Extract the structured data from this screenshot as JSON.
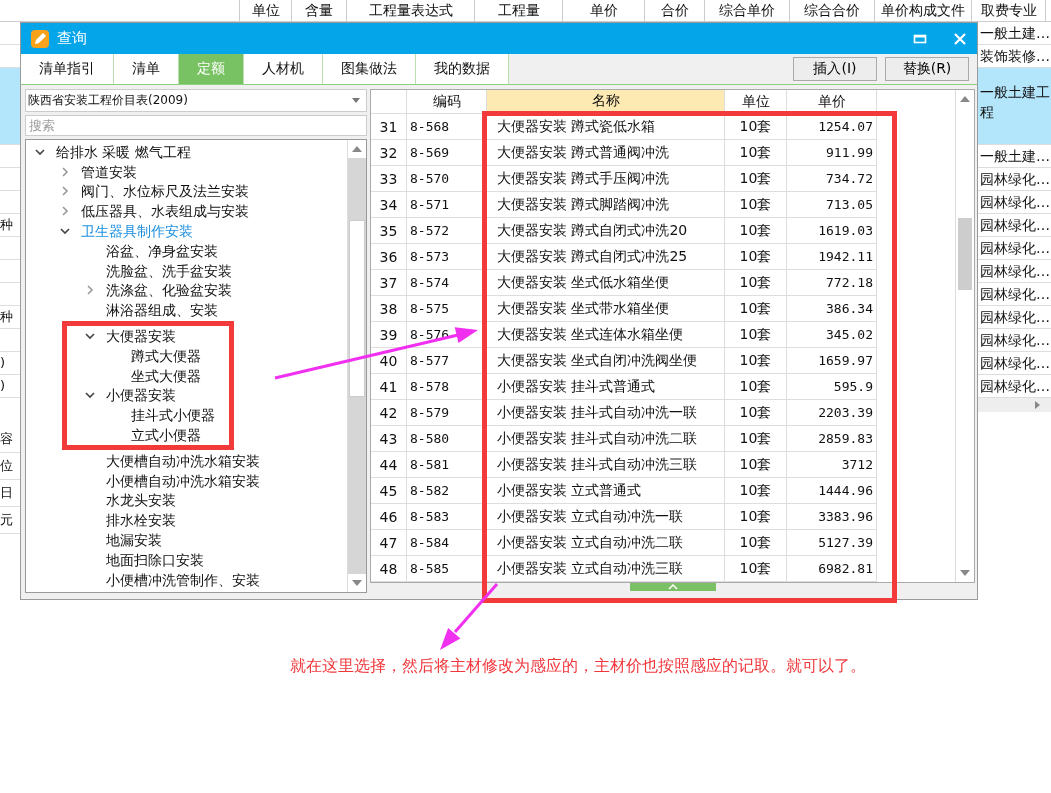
{
  "background_sheet": {
    "columns": [
      "单位",
      "含量",
      "工程量表达式",
      "工程量",
      "单价",
      "合价",
      "综合单价",
      "综合合价",
      "单价构成文件",
      "取费专业"
    ],
    "rows": [
      {
        "fee": "一般土建…",
        "selected": false
      },
      {
        "fee": "装饰装修…",
        "selected": false
      },
      {
        "fee": "一般土建工程",
        "selected": true
      },
      {
        "fee": "一般土建…",
        "selected": false
      },
      {
        "fee": "园林绿化…",
        "selected": false
      },
      {
        "fee": "园林绿化…",
        "selected": false
      },
      {
        "left": "种",
        "fee": "园林绿化…",
        "selected": false
      },
      {
        "fee": "园林绿化…",
        "selected": false
      },
      {
        "fee": "园林绿化…",
        "selected": false
      },
      {
        "fee": "园林绿化…",
        "selected": false
      },
      {
        "left": "种",
        "fee": "园林绿化…",
        "selected": false
      },
      {
        "fee": "园林绿化…",
        "selected": false
      },
      {
        "left": ")",
        "fee": "园林绿化…",
        "selected": false
      },
      {
        "left": ")",
        "fee": "园林绿化…",
        "selected": false
      }
    ],
    "lower_left": [
      "容",
      "位",
      "日",
      "元"
    ]
  },
  "dialog": {
    "title": "查询",
    "tabs": [
      {
        "label": "清单指引",
        "selected": false
      },
      {
        "label": "清单",
        "selected": false
      },
      {
        "label": "定额",
        "selected": true
      },
      {
        "label": "人材机",
        "selected": false
      },
      {
        "label": "图集做法",
        "selected": false
      },
      {
        "label": "我的数据",
        "selected": false
      }
    ],
    "buttons": [
      "插入(I)",
      "替换(R)"
    ],
    "library": {
      "value": "陕西省安装工程价目表(2009)"
    },
    "search": {
      "placeholder": "搜索"
    },
    "tree": [
      {
        "label": "给排水 采暖 燃气工程",
        "expanded": true,
        "selected": false,
        "children": [
          {
            "label": "管道安装",
            "expanded": false,
            "selected": false
          },
          {
            "label": "阀门、水位标尺及法兰安装",
            "expanded": false,
            "selected": false
          },
          {
            "label": "低压器具、水表组成与安装",
            "expanded": false,
            "selected": false
          },
          {
            "label": "卫生器具制作安装",
            "expanded": true,
            "selected": true,
            "children": [
              {
                "label": "浴盆、净身盆安装",
                "selected": false,
                "highlighted": false
              },
              {
                "label": "洗脸盆、洗手盆安装",
                "selected": false,
                "highlighted": false
              },
              {
                "label": "洗涤盆、化验盆安装",
                "expanded": false,
                "selected": false,
                "highlighted": false
              },
              {
                "label": "淋浴器组成、安装",
                "selected": false,
                "highlighted": false
              },
              {
                "label": "大便器安装",
                "expanded": true,
                "selected": false,
                "highlighted": true,
                "children": [
                  {
                    "label": "蹲式大便器",
                    "selected": false
                  },
                  {
                    "label": "坐式大便器",
                    "selected": false
                  }
                ]
              },
              {
                "label": "小便器安装",
                "expanded": true,
                "selected": false,
                "highlighted": true,
                "children": [
                  {
                    "label": "挂斗式小便器",
                    "selected": false
                  },
                  {
                    "label": "立式小便器",
                    "selected": false
                  }
                ]
              },
              {
                "label": "大便槽自动冲洗水箱安装",
                "selected": false,
                "highlighted": false
              },
              {
                "label": "小便槽自动冲洗水箱安装",
                "selected": false,
                "highlighted": false
              },
              {
                "label": "水龙头安装",
                "selected": false,
                "highlighted": false
              },
              {
                "label": "排水栓安装",
                "selected": false,
                "highlighted": false
              },
              {
                "label": "地漏安装",
                "selected": false,
                "highlighted": false
              },
              {
                "label": "地面扫除口安装",
                "selected": false,
                "highlighted": false
              },
              {
                "label": "小便槽冲洗管制作、安装",
                "selected": false,
                "highlighted": false
              }
            ]
          }
        ]
      }
    ],
    "table": {
      "columns": [
        "编码",
        "名称",
        "单位",
        "单价"
      ],
      "highlighted": true,
      "rows": [
        {
          "index": "31",
          "code": "8-568",
          "name": "大便器安装 蹲式瓷低水箱",
          "unit": "10套",
          "price": "1254.07"
        },
        {
          "index": "32",
          "code": "8-569",
          "name": "大便器安装 蹲式普通阀冲洗",
          "unit": "10套",
          "price": "911.99"
        },
        {
          "index": "33",
          "code": "8-570",
          "name": "大便器安装 蹲式手压阀冲洗",
          "unit": "10套",
          "price": "734.72"
        },
        {
          "index": "34",
          "code": "8-571",
          "name": "大便器安装 蹲式脚踏阀冲洗",
          "unit": "10套",
          "price": "713.05"
        },
        {
          "index": "35",
          "code": "8-572",
          "name": "大便器安装 蹲式自闭式冲洗20",
          "unit": "10套",
          "price": "1619.03"
        },
        {
          "index": "36",
          "code": "8-573",
          "name": "大便器安装 蹲式自闭式冲洗25",
          "unit": "10套",
          "price": "1942.11"
        },
        {
          "index": "37",
          "code": "8-574",
          "name": "大便器安装 坐式低水箱坐便",
          "unit": "10套",
          "price": "772.18"
        },
        {
          "index": "38",
          "code": "8-575",
          "name": "大便器安装 坐式带水箱坐便",
          "unit": "10套",
          "price": "386.34"
        },
        {
          "index": "39",
          "code": "8-576",
          "name": "大便器安装 坐式连体水箱坐便",
          "unit": "10套",
          "price": "345.02"
        },
        {
          "index": "40",
          "code": "8-577",
          "name": "大便器安装 坐式自闭冲洗阀坐便",
          "unit": "10套",
          "price": "1659.97"
        },
        {
          "index": "41",
          "code": "8-578",
          "name": "小便器安装 挂斗式普通式",
          "unit": "10套",
          "price": "595.9"
        },
        {
          "index": "42",
          "code": "8-579",
          "name": "小便器安装 挂斗式自动冲洗一联",
          "unit": "10套",
          "price": "2203.39"
        },
        {
          "index": "43",
          "code": "8-580",
          "name": "小便器安装 挂斗式自动冲洗二联",
          "unit": "10套",
          "price": "2859.83"
        },
        {
          "index": "44",
          "code": "8-581",
          "name": "小便器安装 挂斗式自动冲洗三联",
          "unit": "10套",
          "price": "3712"
        },
        {
          "index": "45",
          "code": "8-582",
          "name": "小便器安装 立式普通式",
          "unit": "10套",
          "price": "1444.96"
        },
        {
          "index": "46",
          "code": "8-583",
          "name": "小便器安装 立式自动冲洗一联",
          "unit": "10套",
          "price": "3383.96"
        },
        {
          "index": "47",
          "code": "8-584",
          "name": "小便器安装 立式自动冲洗二联",
          "unit": "10套",
          "price": "5127.39"
        },
        {
          "index": "48",
          "code": "8-585",
          "name": "小便器安装 立式自动冲洗三联",
          "unit": "10套",
          "price": "6982.81"
        }
      ]
    }
  },
  "annotation": {
    "note": "就在这里选择，然后将主材修改为感应的，主材价也按照感应的记取。就可以了。"
  }
}
